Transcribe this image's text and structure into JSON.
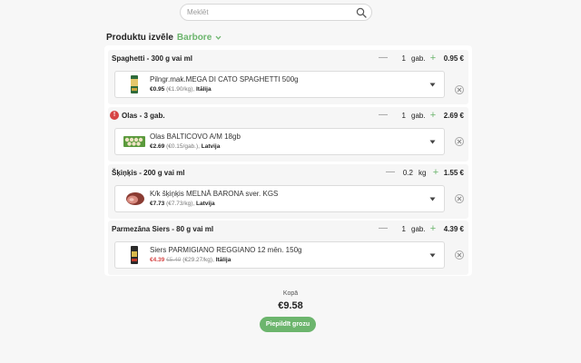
{
  "search": {
    "placeholder": "Meklēt",
    "value": ""
  },
  "header": {
    "title": "Produktu izvēle",
    "store": "Barbore"
  },
  "groups": [
    {
      "name": "Spaghetti - 300 g vai ml",
      "alert": "",
      "quantity": "1",
      "unit": "gab.",
      "price": "0.95 €",
      "product": {
        "name": "Pilngr.mak.MEGA DI CATO SPAGHETTI 500g",
        "price": "€0.95",
        "old_price": "",
        "unit_price": "(€1.90/kg),",
        "origin": "Itālija"
      }
    },
    {
      "name": "Olas - 3 gab.",
      "alert": "!",
      "quantity": "1",
      "unit": "gab.",
      "price": "2.69 €",
      "product": {
        "name": "Olas BALTICOVO A/M 18gb",
        "price": "€2.69",
        "old_price": "",
        "unit_price": "(€0.15/gab.),",
        "origin": "Latvija"
      }
    },
    {
      "name": "Šķiņķis - 200 g vai ml",
      "alert": "",
      "quantity": "0.2",
      "unit": "kg",
      "price": "1.55 €",
      "product": {
        "name": "K/k šķiņķis MELNĀ BARONA sver. KGS",
        "price": "€7.73",
        "old_price": "",
        "unit_price": "(€7.73/kg),",
        "origin": "Latvija"
      }
    },
    {
      "name": "Parmezāna Siers - 80 g vai ml",
      "alert": "",
      "quantity": "1",
      "unit": "gab.",
      "price": "4.39 €",
      "product": {
        "name": "Siers PARMIGIANO REGGIANO 12 mēn. 150g",
        "price": "€4.39",
        "old_price": "€5.49",
        "unit_price": "(€29.27/kg),",
        "origin": "Itālija"
      }
    }
  ],
  "footer": {
    "total_label": "Kopā",
    "total_value": "€9.58",
    "fill_button": "Piepildīt grozu"
  },
  "colors": {
    "accent": "#6cb56d",
    "alert": "#d64545",
    "sale": "#d64545"
  },
  "icons": [
    "search-icon",
    "chevron-down-icon",
    "minus-icon",
    "plus-icon",
    "close-icon",
    "alert-icon",
    "dropdown-arrow-icon"
  ]
}
